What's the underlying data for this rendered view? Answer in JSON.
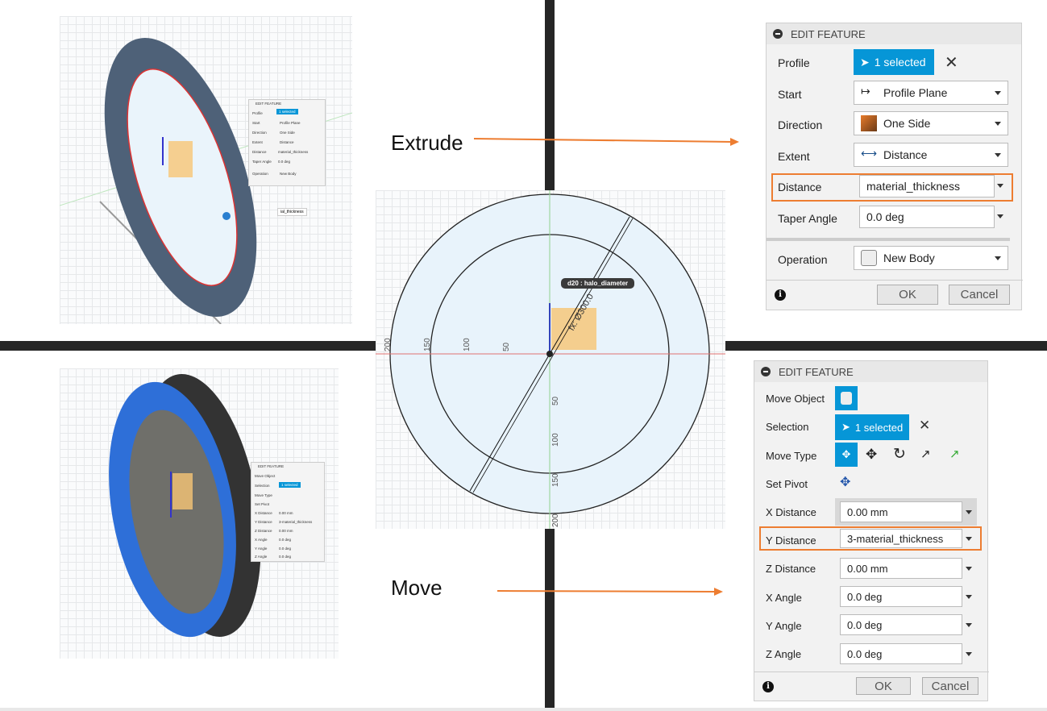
{
  "labels": {
    "extrude": "Extrude",
    "move": "Move"
  },
  "colors": {
    "accent": "#ed7d31",
    "selected": "#0696d7",
    "dark_bar": "#262626",
    "ring_top": "#4e6178",
    "ring_bottom": "#2e6fd8"
  },
  "sketch": {
    "dimension_tooltip": "d20 : halo_diameter",
    "dimension_value": "fx: Ø300.0",
    "h_ticks": [
      "200",
      "150",
      "100",
      "50"
    ],
    "v_ticks": [
      "50",
      "100",
      "150",
      "200"
    ]
  },
  "extrude": {
    "title": "EDIT FEATURE",
    "profile": {
      "label": "Profile",
      "value": "1 selected",
      "icon": "cursor-icon"
    },
    "start": {
      "label": "Start",
      "value": "Profile Plane",
      "icon": "profile-plane-icon"
    },
    "direction": {
      "label": "Direction",
      "value": "One Side",
      "icon": "one-side-icon"
    },
    "extent": {
      "label": "Extent",
      "value": "Distance",
      "icon": "distance-icon"
    },
    "distance": {
      "label": "Distance",
      "value": "material_thickness"
    },
    "taper": {
      "label": "Taper Angle",
      "value": "0.0 deg"
    },
    "operation": {
      "label": "Operation",
      "value": "New Body",
      "icon": "new-body-icon"
    },
    "ok": "OK",
    "cancel": "Cancel",
    "mini_tag": "ial_thickness"
  },
  "move": {
    "title": "EDIT FEATURE",
    "move_object": {
      "label": "Move Object"
    },
    "selection": {
      "label": "Selection",
      "value": "1 selected"
    },
    "move_type": {
      "label": "Move Type",
      "options": [
        "free-move-icon",
        "translate-icon",
        "rotate-icon",
        "point-to-point-icon",
        "point-to-position-icon"
      ],
      "selected": "free-move-icon"
    },
    "set_pivot": {
      "label": "Set Pivot"
    },
    "x_distance": {
      "label": "X Distance",
      "value": "0.00 mm"
    },
    "y_distance": {
      "label": "Y Distance",
      "value": "3-material_thickness"
    },
    "z_distance": {
      "label": "Z Distance",
      "value": "0.00 mm"
    },
    "x_angle": {
      "label": "X Angle",
      "value": "0.0 deg"
    },
    "y_angle": {
      "label": "Y Angle",
      "value": "0.0 deg"
    },
    "z_angle": {
      "label": "Z Angle",
      "value": "0.0 deg"
    },
    "ok": "OK",
    "cancel": "Cancel"
  }
}
